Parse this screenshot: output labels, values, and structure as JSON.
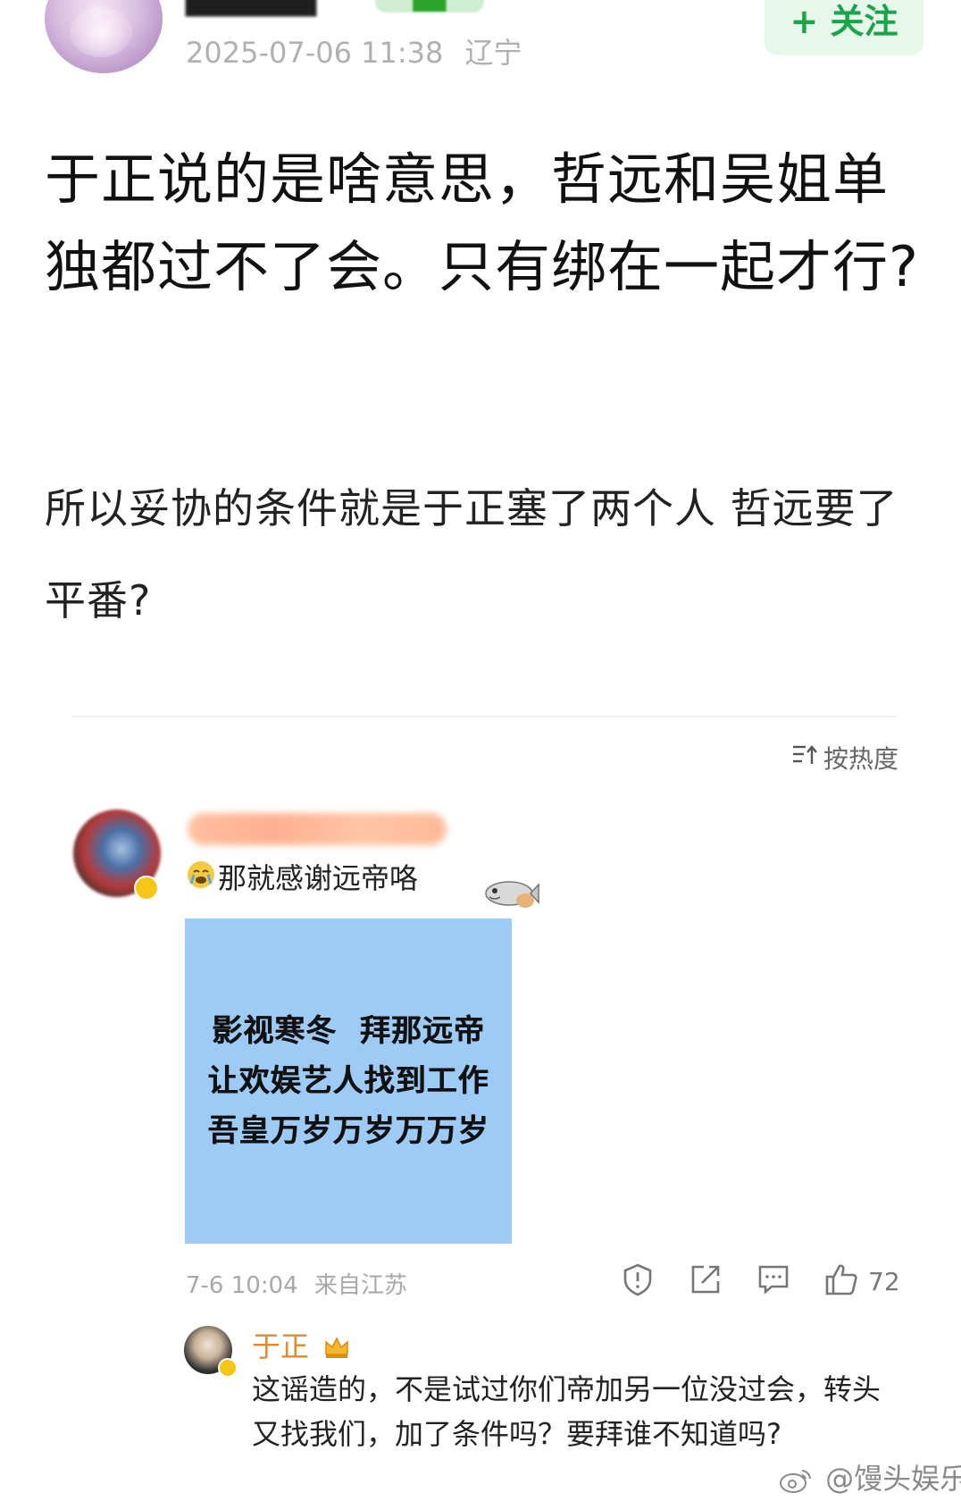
{
  "post": {
    "timestamp": "2025-07-06 11:38",
    "location": "辽宁",
    "follow_label": "+ 关注",
    "title": "于正说的是啥意思，哲远和吴姐单独都过不了会。只有绑在一起才行?",
    "text": "所以妥协的条件就是于正塞了两个人 哲远要了平番?"
  },
  "comments": {
    "sort_label": "按热度",
    "sort_icon": "sort-icon",
    "first": {
      "text": "那就感谢远帝咯",
      "meme_lines": [
        "影视寒冬  拜那远帝",
        "让欢娱艺人找到工作",
        "吾皇万岁万岁万万岁"
      ],
      "date": "7-6 10:04",
      "source": "来自江苏",
      "like_count": "72",
      "actions": [
        "report-icon",
        "share-icon",
        "comment-icon",
        "like-icon"
      ]
    },
    "reply": {
      "author": "于正",
      "text": "这谣造的，不是试过你们帝加另一位没过会，转头又找我们，加了条件吗？要拜谁不知道吗?"
    }
  },
  "watermark": "@馒头娱乐酱",
  "colors": {
    "follow_text": "#1aa54a",
    "follow_bg": "#e7f7ea",
    "reply_name": "#e08a2a",
    "meme_bg": "#9dcbf5"
  }
}
